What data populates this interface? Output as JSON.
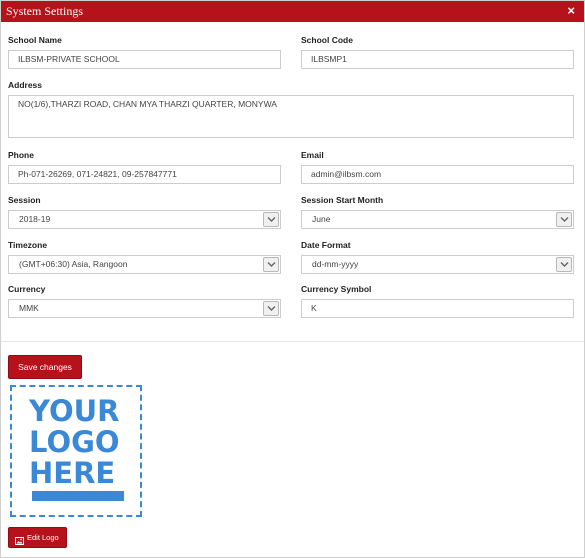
{
  "header": {
    "title": "System Settings",
    "close_label": "×"
  },
  "fields": {
    "school_name": {
      "label": "School Name",
      "value": "ILBSM-PRIVATE SCHOOL"
    },
    "school_code": {
      "label": "School Code",
      "value": "ILBSMP1"
    },
    "address": {
      "label": "Address",
      "value": "NO(1/6),THARZI ROAD, CHAN MYA THARZI QUARTER, MONYWA"
    },
    "phone": {
      "label": "Phone",
      "value": "Ph-071-26269, 071-24821, 09-257847771"
    },
    "email": {
      "label": "Email",
      "value": "admin@ilbsm.com"
    },
    "session": {
      "label": "Session",
      "value": "2018-19"
    },
    "session_start_month": {
      "label": "Session Start Month",
      "value": "June"
    },
    "timezone": {
      "label": "Timezone",
      "value": "(GMT+06:30) Asia, Rangoon"
    },
    "date_format": {
      "label": "Date Format",
      "value": "dd-mm-yyyy"
    },
    "currency": {
      "label": "Currency",
      "value": "MMK"
    },
    "currency_symbol": {
      "label": "Currency Symbol",
      "value": "K"
    }
  },
  "actions": {
    "save_label": "Save changes",
    "edit_logo_label": "Edit Logo"
  },
  "logo": {
    "lines": [
      "YOUR",
      "LOGO",
      "HERE"
    ]
  },
  "colors": {
    "accent": "#b5121b",
    "logo_blue": "#3b88d6"
  }
}
